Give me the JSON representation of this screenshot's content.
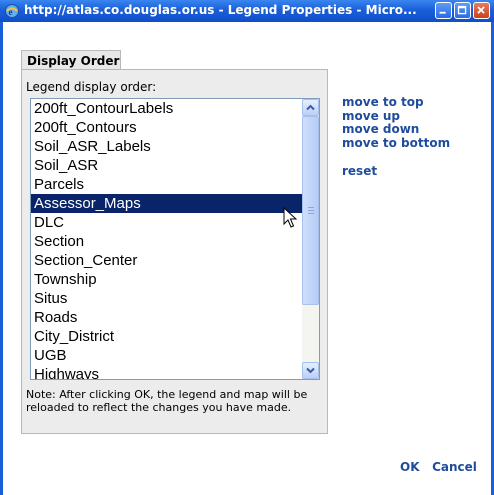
{
  "window": {
    "title": "http://atlas.co.douglas.or.us - Legend Properties - Micro...",
    "icon": "ie-icon",
    "controls": [
      "minimize-icon",
      "maximize-icon",
      "close-icon"
    ]
  },
  "tab": {
    "label": "Display Order"
  },
  "panel": {
    "label": "Legend display order:",
    "items": [
      "200ft_ContourLabels",
      "200ft_Contours",
      "Soil_ASR_Labels",
      "Soil_ASR",
      "Parcels",
      "Assessor_Maps",
      "DLC",
      "Section",
      "Section_Center",
      "Township",
      "Situs",
      "Roads",
      "City_District",
      "UGB",
      "Highways"
    ],
    "selected": "Assessor_Maps",
    "note": "Note: After clicking OK, the legend and map will be reloaded to reflect the changes you have made."
  },
  "actions": {
    "move_top": "move to top",
    "move_up": "move up",
    "move_down": "move down",
    "move_bottom": "move to bottom",
    "reset": "reset"
  },
  "buttons": {
    "ok": "OK",
    "cancel": "Cancel"
  },
  "colors": {
    "titlebar": "#1a5fd8",
    "link": "#1f4c9c",
    "selection": "#0a246a"
  }
}
